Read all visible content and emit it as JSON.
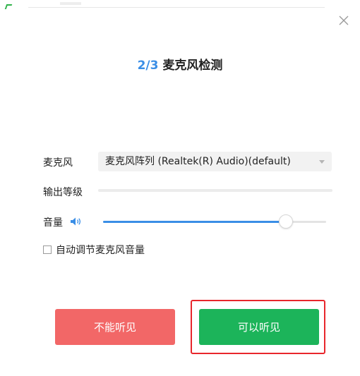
{
  "dialog": {
    "step": "2/3",
    "title": "麦克风检测"
  },
  "microphone": {
    "label": "麦克风",
    "selected_device": "麦克风阵列 (Realtek(R) Audio)(default)"
  },
  "output_level": {
    "label": "输出等级",
    "level": 0
  },
  "volume": {
    "label": "音量",
    "value_fraction": 0.84
  },
  "auto_adjust": {
    "label": "自动调节麦克风音量",
    "checked": false
  },
  "buttons": {
    "cannot_hear": "不能听见",
    "can_hear": "可以听见"
  },
  "colors": {
    "accent_blue": "#3a8ee6",
    "danger_red": "#f26767",
    "success_green": "#1cb45a",
    "highlight_red": "#e8262c"
  },
  "icons": {
    "close": "close-icon",
    "volume": "speaker-icon",
    "dropdown": "caret-down-icon"
  }
}
